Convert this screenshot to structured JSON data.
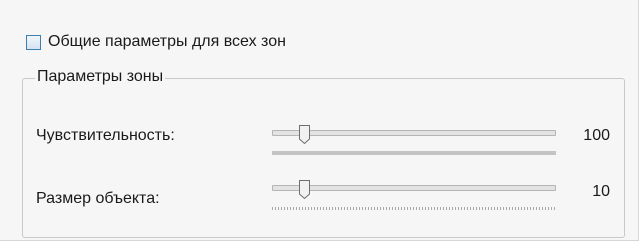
{
  "shared_params": {
    "label": "Общие параметры для всех зон",
    "checked": false
  },
  "zone_group": {
    "title": "Параметры зоны",
    "sensitivity": {
      "label": "Чувствительность:",
      "value": "100",
      "level": 0.1
    },
    "object_size": {
      "label": "Размер объекта:",
      "value": "10",
      "level": 0.1
    }
  },
  "colors": {
    "accent": "#3c7fb1",
    "panel": "#f6f6f6"
  }
}
